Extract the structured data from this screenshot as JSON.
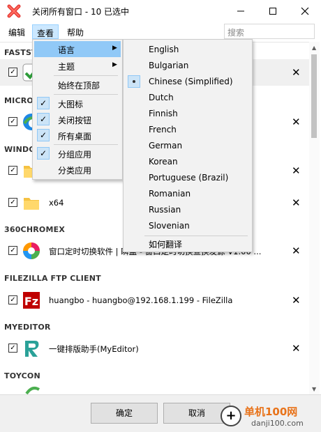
{
  "window": {
    "title": "关闭所有窗口 - 10 已选中",
    "app_icon": "red-x-icon",
    "controls": [
      "minimize-icon",
      "maximize-icon",
      "close-icon"
    ]
  },
  "menubar": {
    "items": [
      {
        "label": "编辑"
      },
      {
        "label": "查看"
      },
      {
        "label": "帮助"
      }
    ],
    "search_placeholder": "搜索"
  },
  "groups": [
    {
      "header": "FASTST",
      "rows": [
        {
          "text": "",
          "icon": "green-check-app-icon",
          "checked": true
        }
      ]
    },
    {
      "header": "MICRO",
      "rows": [
        {
          "text": "e",
          "icon": "edge-icon",
          "checked": true
        }
      ]
    },
    {
      "header": "WINDO",
      "rows": [
        {
          "text": "",
          "icon": "folder-icon",
          "checked": true
        },
        {
          "text": "x64",
          "icon": "folder-icon",
          "checked": true
        }
      ]
    },
    {
      "header": "360CHROMEX",
      "rows": [
        {
          "text": "窗口定时切换软件 | 瞬盖 - 窗口定时切换宣换发源 V1.00 ...",
          "icon": "360chromex-icon",
          "checked": true
        }
      ]
    },
    {
      "header": "FILEZILLA FTP CLIENT",
      "rows": [
        {
          "text": "huangbo - huangbo@192.168.1.199 - FileZilla",
          "icon": "filezilla-icon",
          "checked": true
        }
      ]
    },
    {
      "header": "MYEDITOR",
      "rows": [
        {
          "text": "一键排版助手(MyEditor)",
          "icon": "myeditor-icon",
          "checked": true
        }
      ]
    },
    {
      "header": "TOYCON",
      "rows": []
    }
  ],
  "view_menu": {
    "items": [
      {
        "label": "语言",
        "submenu": true,
        "checked": false
      },
      {
        "label": "主题",
        "submenu": true,
        "checked": false
      },
      {
        "label": "始终在顶部",
        "checked": false
      },
      {
        "label": "大图标",
        "checked": true
      },
      {
        "label": "关闭按钮",
        "checked": true
      },
      {
        "label": "所有桌面",
        "checked": true
      },
      {
        "label": "分组应用",
        "checked": true
      },
      {
        "label": "分类应用",
        "checked": false
      }
    ]
  },
  "language_menu": {
    "items": [
      "English",
      "Bulgarian",
      "Chinese (Simplified)",
      "Dutch",
      "Finnish",
      "French",
      "German",
      "Korean",
      "Portuguese (Brazil)",
      "Romanian",
      "Russian",
      "Slovenian"
    ],
    "selected": "Chinese (Simplified)",
    "translate_label": "如何翻译"
  },
  "footer": {
    "ok_label": "确定",
    "cancel_label": "取消"
  },
  "watermark": {
    "title": "单机100网",
    "url": "danji100.com"
  },
  "colors": {
    "highlight": "#91c9f7",
    "menu_active": "#cce8ff",
    "app_icon_red": "#e53935"
  }
}
